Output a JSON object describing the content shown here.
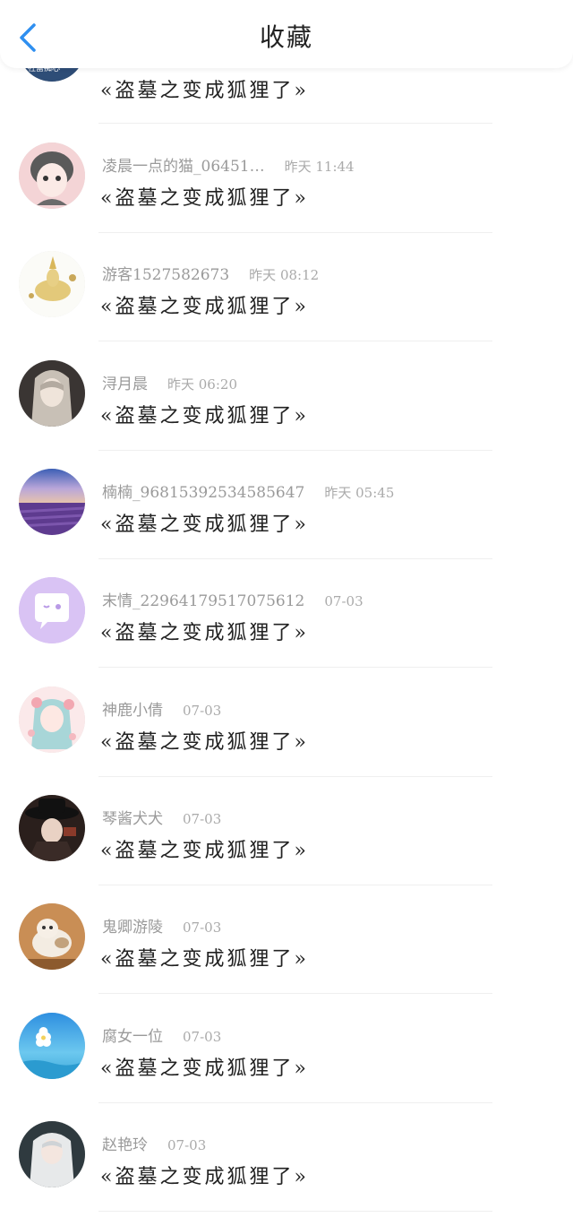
{
  "header": {
    "title": "收藏",
    "accent": "#2f8ff0"
  },
  "items": [
    {
      "user": "",
      "time": "",
      "title": "«盗墓之变成狐狸了»",
      "avatar": "avatar-top-partial"
    },
    {
      "user": "凌晨一点的猫_06451…",
      "time": "昨天 11:44",
      "title": "«盗墓之变成狐狸了»",
      "avatar": "anime-girl-grey-hair"
    },
    {
      "user": "游客1527582673",
      "time": "昨天 08:12",
      "title": "«盗墓之变成狐狸了»",
      "avatar": "golden-creature"
    },
    {
      "user": "浔月晨",
      "time": "昨天 06:20",
      "title": "«盗墓之变成狐狸了»",
      "avatar": "anime-silver-hair"
    },
    {
      "user": "楠楠_96815392534585647",
      "time": "昨天 05:45",
      "title": "«盗墓之变成狐狸了»",
      "avatar": "lavender-field"
    },
    {
      "user": "末情_22964179517075612",
      "time": "07-03",
      "title": "«盗墓之变成狐狸了»",
      "avatar": "purple-chat-bubble"
    },
    {
      "user": "神鹿小倩",
      "time": "07-03",
      "title": "«盗墓之变成狐狸了»",
      "avatar": "pink-anime-girl"
    },
    {
      "user": "琴酱犬犬",
      "time": "07-03",
      "title": "«盗墓之变成狐狸了»",
      "avatar": "dark-hat-character"
    },
    {
      "user": "鬼卿游陵",
      "time": "07-03",
      "title": "«盗墓之变成狐狸了»",
      "avatar": "cat-photo"
    },
    {
      "user": "腐女一位",
      "time": "07-03",
      "title": "«盗墓之变成狐狸了»",
      "avatar": "sky-flower"
    },
    {
      "user": "赵艳玲",
      "time": "07-03",
      "title": "«盗墓之变成狐狸了»",
      "avatar": "white-hair-girl"
    }
  ]
}
